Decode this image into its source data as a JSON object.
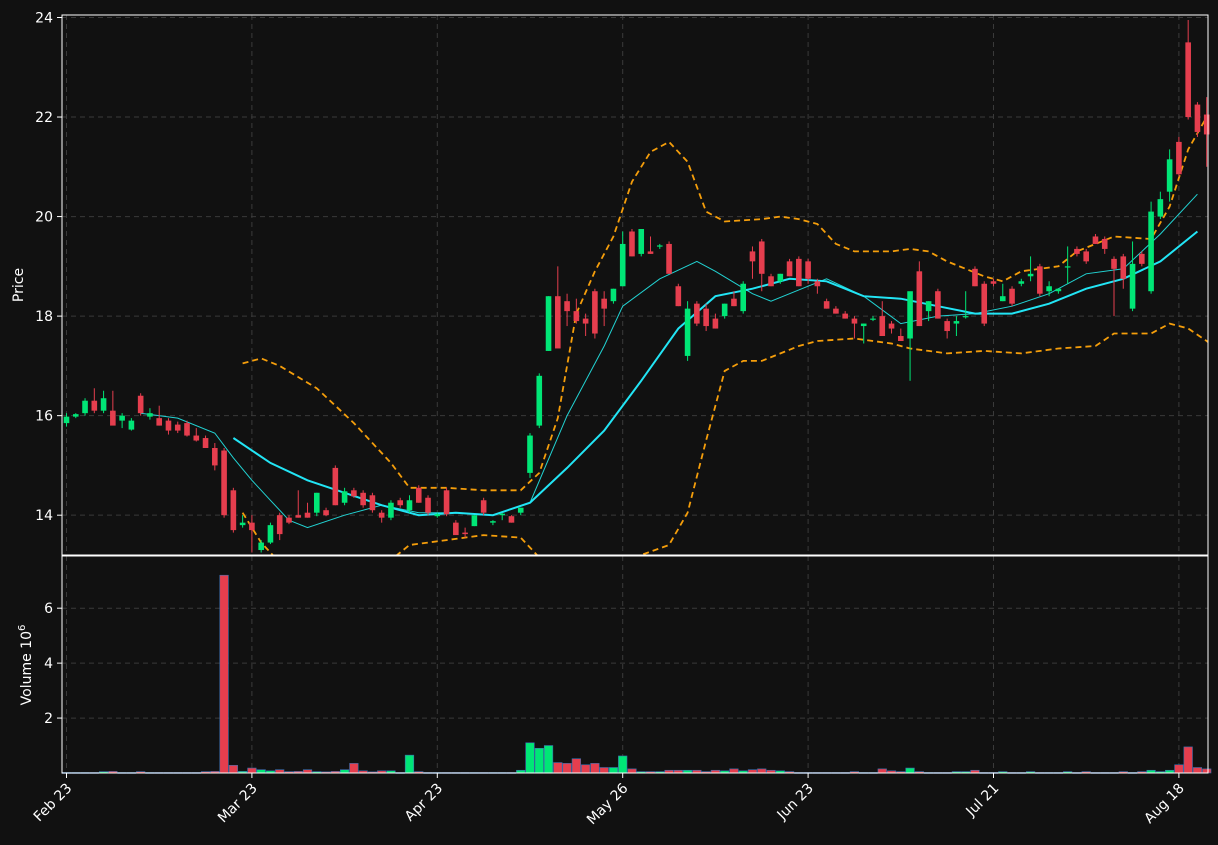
{
  "colors": {
    "background": "#111111",
    "up": "#00e676",
    "down": "#e53e4e",
    "ma_long": "#22e5f5",
    "ma_short": "#22d3d3",
    "band": "#f59e0b",
    "grid": "#3a3a3a",
    "frame": "#ffffff"
  },
  "chart_data": {
    "type": "candlestick",
    "ylabel_price": "Price",
    "ylabel_volume": "Volume",
    "volume_exponent_base": "10",
    "volume_exponent_power": "6",
    "x_tick_labels": [
      {
        "label": "Feb 23",
        "index": 0
      },
      {
        "label": "Mar 23",
        "index": 20
      },
      {
        "label": "Apr 23",
        "index": 40
      },
      {
        "label": "May 26",
        "index": 60
      },
      {
        "label": "Jun 23",
        "index": 80
      },
      {
        "label": "Jul 21",
        "index": 100
      },
      {
        "label": "Aug 18",
        "index": 120
      }
    ],
    "price_ticks": [
      "14",
      "16",
      "18",
      "20",
      "22",
      "24"
    ],
    "volume_ticks": [
      "2",
      "4",
      "6"
    ],
    "price_range": [
      13.2,
      24.05
    ],
    "volume_range": [
      0,
      7.9
    ],
    "grid": true,
    "candles": [
      [
        15.85,
        16.05,
        15.78,
        15.98,
        0.02
      ],
      [
        15.98,
        16.05,
        15.95,
        16.03,
        0.02
      ],
      [
        16.05,
        16.35,
        16.0,
        16.3,
        0.02
      ],
      [
        16.3,
        16.55,
        16.05,
        16.1,
        0.02
      ],
      [
        16.1,
        16.5,
        16.05,
        16.35,
        0.05
      ],
      [
        16.1,
        16.5,
        15.85,
        15.8,
        0.06
      ],
      [
        15.9,
        16.05,
        15.75,
        16.0,
        0.02
      ],
      [
        15.72,
        15.95,
        15.7,
        15.9,
        0.02
      ],
      [
        16.4,
        16.45,
        16.0,
        16.05,
        0.05
      ],
      [
        15.98,
        16.15,
        15.92,
        16.05,
        0.02
      ],
      [
        15.95,
        16.2,
        15.8,
        15.8,
        0.02
      ],
      [
        15.9,
        15.95,
        15.62,
        15.7,
        0.02
      ],
      [
        15.82,
        15.88,
        15.65,
        15.7,
        0.02
      ],
      [
        15.85,
        15.9,
        15.58,
        15.6,
        0.02
      ],
      [
        15.6,
        15.75,
        15.48,
        15.5,
        0.02
      ],
      [
        15.55,
        15.6,
        15.35,
        15.35,
        0.05
      ],
      [
        15.35,
        15.45,
        14.9,
        15.0,
        0.06
      ],
      [
        15.3,
        15.35,
        13.95,
        14.0,
        7.2
      ],
      [
        14.5,
        14.55,
        13.65,
        13.7,
        0.28
      ],
      [
        13.8,
        14.0,
        13.75,
        13.85,
        0.06
      ],
      [
        13.85,
        14.0,
        13.25,
        13.7,
        0.18
      ],
      [
        13.3,
        13.5,
        13.25,
        13.45,
        0.12
      ],
      [
        13.45,
        13.85,
        13.42,
        13.8,
        0.08
      ],
      [
        14.0,
        14.05,
        13.5,
        13.62,
        0.12
      ],
      [
        13.95,
        14.0,
        13.82,
        13.85,
        0.05
      ],
      [
        14.0,
        14.5,
        13.95,
        13.95,
        0.06
      ],
      [
        14.05,
        14.25,
        13.95,
        13.95,
        0.12
      ],
      [
        14.05,
        14.45,
        13.98,
        14.45,
        0.05
      ],
      [
        14.1,
        14.15,
        13.98,
        14.0,
        0.04
      ],
      [
        14.95,
        15.0,
        14.2,
        14.2,
        0.06
      ],
      [
        14.25,
        14.55,
        14.2,
        14.48,
        0.12
      ],
      [
        14.5,
        14.55,
        14.35,
        14.38,
        0.35
      ],
      [
        14.45,
        14.5,
        14.15,
        14.2,
        0.08
      ],
      [
        14.4,
        14.45,
        14.05,
        14.1,
        0.04
      ],
      [
        14.05,
        14.1,
        13.85,
        13.95,
        0.08
      ],
      [
        13.95,
        14.3,
        13.9,
        14.25,
        0.08
      ],
      [
        14.3,
        14.35,
        14.15,
        14.2,
        0.02
      ],
      [
        14.1,
        14.4,
        14.05,
        14.3,
        0.65
      ],
      [
        14.55,
        14.6,
        14.25,
        14.25,
        0.05
      ],
      [
        14.35,
        14.4,
        14.0,
        14.05,
        0.02
      ],
      [
        13.98,
        14.05,
        13.95,
        14.02,
        0.02
      ],
      [
        14.5,
        14.55,
        13.98,
        14.02,
        0.02
      ],
      [
        13.85,
        13.9,
        13.62,
        13.6,
        0.02
      ],
      [
        13.65,
        13.75,
        13.55,
        13.62,
        0.02
      ],
      [
        13.78,
        14.0,
        13.78,
        14.0,
        0.02
      ],
      [
        14.3,
        14.35,
        14.0,
        14.05,
        0.02
      ],
      [
        13.85,
        13.9,
        13.8,
        13.88,
        0.02
      ],
      [
        14.0,
        14.05,
        13.9,
        14.03,
        0.02
      ],
      [
        13.98,
        14.0,
        13.85,
        13.85,
        0.02
      ],
      [
        14.05,
        14.15,
        14.0,
        14.15,
        0.1
      ],
      [
        14.85,
        15.65,
        14.75,
        15.6,
        1.1
      ],
      [
        15.8,
        16.85,
        15.75,
        16.8,
        0.9
      ],
      [
        17.3,
        18.4,
        17.3,
        18.4,
        1.0
      ],
      [
        18.4,
        19.0,
        17.4,
        17.35,
        0.38
      ],
      [
        18.3,
        18.45,
        17.8,
        18.1,
        0.35
      ],
      [
        18.1,
        18.35,
        17.85,
        17.9,
        0.52
      ],
      [
        17.95,
        18.05,
        17.6,
        17.85,
        0.3
      ],
      [
        18.5,
        18.55,
        17.55,
        17.65,
        0.35
      ],
      [
        18.35,
        18.5,
        17.8,
        18.15,
        0.2
      ],
      [
        18.3,
        18.55,
        18.25,
        18.55,
        0.2
      ],
      [
        18.6,
        19.7,
        18.6,
        19.45,
        0.62
      ],
      [
        19.7,
        19.75,
        19.2,
        19.2,
        0.15
      ],
      [
        19.25,
        19.75,
        19.2,
        19.75,
        0.05
      ],
      [
        19.3,
        19.6,
        19.25,
        19.25,
        0.05
      ],
      [
        19.4,
        19.45,
        19.35,
        19.42,
        0.05
      ],
      [
        19.45,
        19.5,
        18.85,
        18.85,
        0.1
      ],
      [
        18.6,
        18.65,
        18.2,
        18.2,
        0.1
      ],
      [
        17.2,
        18.3,
        17.1,
        18.15,
        0.1
      ],
      [
        18.25,
        18.3,
        17.8,
        17.85,
        0.1
      ],
      [
        18.15,
        18.25,
        17.7,
        17.8,
        0.05
      ],
      [
        17.95,
        18.05,
        17.75,
        17.75,
        0.1
      ],
      [
        18.0,
        18.25,
        17.95,
        18.25,
        0.08
      ],
      [
        18.35,
        18.5,
        18.2,
        18.2,
        0.15
      ],
      [
        18.1,
        18.7,
        18.05,
        18.65,
        0.08
      ],
      [
        19.3,
        19.4,
        18.75,
        19.1,
        0.12
      ],
      [
        19.5,
        19.55,
        18.5,
        18.85,
        0.15
      ],
      [
        18.8,
        18.85,
        18.6,
        18.6,
        0.1
      ],
      [
        18.7,
        18.85,
        18.65,
        18.85,
        0.08
      ],
      [
        19.1,
        19.15,
        18.8,
        18.8,
        0.05
      ],
      [
        19.15,
        19.2,
        18.6,
        18.6,
        0.02
      ],
      [
        19.1,
        19.15,
        18.65,
        18.75,
        0.02
      ],
      [
        18.7,
        18.75,
        18.45,
        18.6,
        0.02
      ],
      [
        18.3,
        18.35,
        18.15,
        18.15,
        0.02
      ],
      [
        18.15,
        18.2,
        18.05,
        18.05,
        0.02
      ],
      [
        18.05,
        18.1,
        17.95,
        17.95,
        0.02
      ],
      [
        17.95,
        18.0,
        17.55,
        17.85,
        0.05
      ],
      [
        17.8,
        17.85,
        17.45,
        17.85,
        0.02
      ],
      [
        17.95,
        18.0,
        17.9,
        17.95,
        0.02
      ],
      [
        18.0,
        18.3,
        17.6,
        17.6,
        0.15
      ],
      [
        17.85,
        17.9,
        17.65,
        17.75,
        0.08
      ],
      [
        17.6,
        17.75,
        17.5,
        17.5,
        0.05
      ],
      [
        17.55,
        17.7,
        16.7,
        18.5,
        0.18
      ],
      [
        18.9,
        19.1,
        17.8,
        17.8,
        0.05
      ],
      [
        18.1,
        18.3,
        17.9,
        18.3,
        0.02
      ],
      [
        18.5,
        18.55,
        17.95,
        17.95,
        0.02
      ],
      [
        17.9,
        17.95,
        17.55,
        17.7,
        0.02
      ],
      [
        17.85,
        18.0,
        17.6,
        17.9,
        0.05
      ],
      [
        18.0,
        18.5,
        17.95,
        18.0,
        0.05
      ],
      [
        18.95,
        19.0,
        18.6,
        18.6,
        0.1
      ],
      [
        18.65,
        18.7,
        17.8,
        17.85,
        0.02
      ],
      [
        18.7,
        18.75,
        18.6,
        18.65,
        0.02
      ],
      [
        18.3,
        18.65,
        18.3,
        18.4,
        0.05
      ],
      [
        18.55,
        18.6,
        18.2,
        18.25,
        0.02
      ],
      [
        18.65,
        18.75,
        18.6,
        18.7,
        0.02
      ],
      [
        18.8,
        19.2,
        18.7,
        18.85,
        0.05
      ],
      [
        19.0,
        19.05,
        18.4,
        18.45,
        0.02
      ],
      [
        18.5,
        18.7,
        18.4,
        18.6,
        0.02
      ],
      [
        18.5,
        18.55,
        18.45,
        18.55,
        0.02
      ],
      [
        19.0,
        19.4,
        18.65,
        19.0,
        0.05
      ],
      [
        19.35,
        19.4,
        19.2,
        19.25,
        0.02
      ],
      [
        19.3,
        19.35,
        19.05,
        19.1,
        0.05
      ],
      [
        19.6,
        19.65,
        19.45,
        19.45,
        0.02
      ],
      [
        19.55,
        19.6,
        19.25,
        19.35,
        0.02
      ],
      [
        19.15,
        19.2,
        18.0,
        18.95,
        0.02
      ],
      [
        19.2,
        19.25,
        18.55,
        18.75,
        0.05
      ],
      [
        18.15,
        19.5,
        18.1,
        19.05,
        0.02
      ],
      [
        19.25,
        19.3,
        19.0,
        19.05,
        0.05
      ],
      [
        18.5,
        20.3,
        18.45,
        20.1,
        0.1
      ],
      [
        20.0,
        20.5,
        19.95,
        20.35,
        0.05
      ],
      [
        20.5,
        21.35,
        20.3,
        21.15,
        0.1
      ],
      [
        21.5,
        21.6,
        20.8,
        20.85,
        0.3
      ],
      [
        23.5,
        23.95,
        21.95,
        22.0,
        0.95
      ],
      [
        22.25,
        22.3,
        21.6,
        21.7,
        0.2
      ],
      [
        22.05,
        22.4,
        21.0,
        21.65,
        0.15
      ]
    ],
    "ma_long": [
      [
        18,
        15.55
      ],
      [
        22,
        15.05
      ],
      [
        26,
        14.7
      ],
      [
        30,
        14.45
      ],
      [
        34,
        14.2
      ],
      [
        38,
        14.0
      ],
      [
        42,
        14.05
      ],
      [
        46,
        14.0
      ],
      [
        50,
        14.25
      ],
      [
        54,
        14.95
      ],
      [
        58,
        15.7
      ],
      [
        62,
        16.7
      ],
      [
        66,
        17.75
      ],
      [
        70,
        18.4
      ],
      [
        74,
        18.55
      ],
      [
        78,
        18.75
      ],
      [
        82,
        18.7
      ],
      [
        86,
        18.4
      ],
      [
        90,
        18.35
      ],
      [
        94,
        18.2
      ],
      [
        98,
        18.05
      ],
      [
        102,
        18.05
      ],
      [
        106,
        18.25
      ],
      [
        110,
        18.55
      ],
      [
        114,
        18.75
      ],
      [
        118,
        19.1
      ],
      [
        122,
        19.7
      ]
    ],
    "ma_short": [
      [
        8,
        16.05
      ],
      [
        12,
        15.95
      ],
      [
        16,
        15.65
      ],
      [
        18,
        15.15
      ],
      [
        20,
        14.7
      ],
      [
        22,
        14.3
      ],
      [
        24,
        13.9
      ],
      [
        26,
        13.75
      ],
      [
        30,
        14.0
      ],
      [
        34,
        14.2
      ],
      [
        38,
        14.05
      ],
      [
        42,
        14.05
      ],
      [
        46,
        14.0
      ],
      [
        50,
        14.25
      ],
      [
        54,
        16.0
      ],
      [
        58,
        17.4
      ],
      [
        60,
        18.2
      ],
      [
        64,
        18.75
      ],
      [
        68,
        19.1
      ],
      [
        70,
        18.9
      ],
      [
        74,
        18.45
      ],
      [
        76,
        18.3
      ],
      [
        80,
        18.6
      ],
      [
        82,
        18.75
      ],
      [
        86,
        18.4
      ],
      [
        90,
        17.85
      ],
      [
        94,
        18.0
      ],
      [
        98,
        18.05
      ],
      [
        102,
        18.2
      ],
      [
        106,
        18.45
      ],
      [
        110,
        18.85
      ],
      [
        114,
        18.95
      ],
      [
        118,
        19.65
      ],
      [
        122,
        20.45
      ]
    ],
    "band_upper": [
      [
        19,
        17.05
      ],
      [
        21,
        17.15
      ],
      [
        23,
        17.0
      ],
      [
        27,
        16.55
      ],
      [
        31,
        15.85
      ],
      [
        35,
        15.05
      ],
      [
        37,
        14.55
      ],
      [
        41,
        14.55
      ],
      [
        45,
        14.5
      ],
      [
        49,
        14.5
      ],
      [
        51,
        14.85
      ],
      [
        53,
        15.95
      ],
      [
        55,
        18.05
      ],
      [
        57,
        18.9
      ],
      [
        59,
        19.6
      ],
      [
        61,
        20.7
      ],
      [
        63,
        21.3
      ],
      [
        65,
        21.5
      ],
      [
        67,
        21.1
      ],
      [
        69,
        20.1
      ],
      [
        71,
        19.9
      ],
      [
        75,
        19.95
      ],
      [
        77,
        20.0
      ],
      [
        79,
        19.95
      ],
      [
        81,
        19.85
      ],
      [
        83,
        19.45
      ],
      [
        85,
        19.3
      ],
      [
        89,
        19.3
      ],
      [
        91,
        19.35
      ],
      [
        93,
        19.3
      ],
      [
        95,
        19.1
      ],
      [
        99,
        18.8
      ],
      [
        101,
        18.7
      ],
      [
        103,
        18.9
      ],
      [
        107,
        19.0
      ],
      [
        109,
        19.3
      ],
      [
        113,
        19.6
      ],
      [
        117,
        19.55
      ],
      [
        119,
        20.2
      ],
      [
        121,
        21.35
      ],
      [
        123,
        22.0
      ]
    ],
    "band_lower": [
      [
        19,
        14.05
      ],
      [
        21,
        13.45
      ],
      [
        23,
        13.05
      ],
      [
        30,
        13.05
      ],
      [
        35,
        13.1
      ],
      [
        37,
        13.4
      ],
      [
        41,
        13.5
      ],
      [
        45,
        13.6
      ],
      [
        49,
        13.55
      ],
      [
        51,
        13.15
      ],
      [
        53,
        12.8
      ],
      [
        62,
        13.2
      ],
      [
        65,
        13.4
      ],
      [
        67,
        14.05
      ],
      [
        69,
        15.5
      ],
      [
        71,
        16.9
      ],
      [
        73,
        17.1
      ],
      [
        75,
        17.1
      ],
      [
        79,
        17.4
      ],
      [
        81,
        17.5
      ],
      [
        85,
        17.55
      ],
      [
        89,
        17.45
      ],
      [
        91,
        17.35
      ],
      [
        93,
        17.3
      ],
      [
        95,
        17.25
      ],
      [
        99,
        17.3
      ],
      [
        103,
        17.25
      ],
      [
        107,
        17.35
      ],
      [
        111,
        17.4
      ],
      [
        113,
        17.65
      ],
      [
        117,
        17.65
      ],
      [
        119,
        17.85
      ],
      [
        121,
        17.75
      ],
      [
        123,
        17.5
      ],
      [
        124,
        17.35
      ]
    ]
  }
}
